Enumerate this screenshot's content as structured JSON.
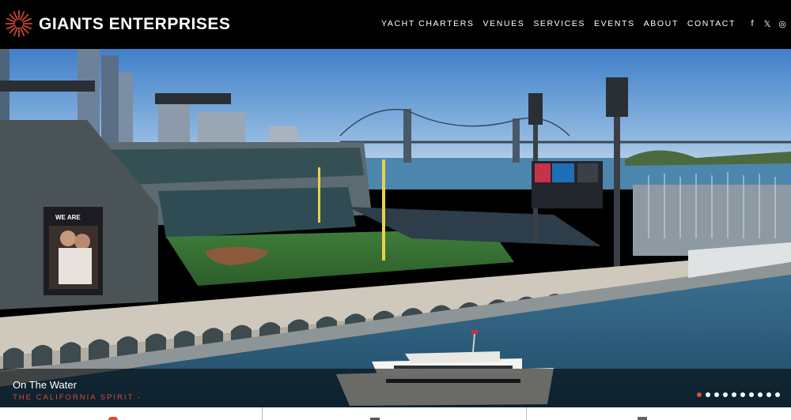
{
  "header": {
    "brand": "GIANTS ENTERPRISES",
    "logo_icon": "starburst-logo-icon",
    "logo_color": "#e0493a",
    "nav": [
      {
        "label": "YACHT CHARTERS"
      },
      {
        "label": "VENUES"
      },
      {
        "label": "SERVICES"
      },
      {
        "label": "EVENTS"
      },
      {
        "label": "ABOUT"
      },
      {
        "label": "CONTACT"
      }
    ],
    "social": [
      {
        "icon": "facebook-icon",
        "glyph": "f"
      },
      {
        "icon": "twitter-icon",
        "glyph": "𝕏"
      },
      {
        "icon": "instagram-icon",
        "glyph": "◎"
      }
    ]
  },
  "hero": {
    "caption_title": "On The Water",
    "caption_subtitle": "THE CALIFORNIA SPIRIT -",
    "slide_count": 10,
    "active_slide": 1,
    "accent_color": "#e0493a",
    "stadium_sign": "WE ARE"
  }
}
